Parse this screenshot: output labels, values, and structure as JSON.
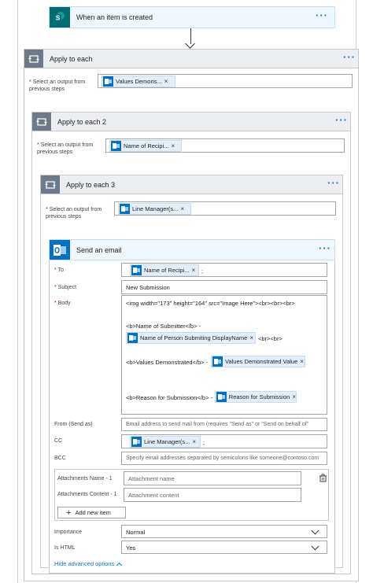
{
  "trigger": {
    "title": "When an item is created"
  },
  "loop1": {
    "title": "Apply to each",
    "label": "Select an output from previous steps",
    "token": "Values Demons..."
  },
  "loop2": {
    "title": "Apply to each 2",
    "label": "Select an output from previous steps",
    "token": "Name of Recipi..."
  },
  "loop3": {
    "title": "Apply to each 3",
    "label": "Select an output from previous steps",
    "token": "Line Manager(s..."
  },
  "email": {
    "title": "Send an email",
    "to_label": "To",
    "to_token": "Name of Recipi...",
    "to_suffix": ";",
    "subject_label": "Subject",
    "subject_value": "New Submission",
    "body_label": "Body",
    "body_line1": "<img width=\"173\" height=\"164\" src=\"Image Here\"><br><br><br>",
    "body_line2": "<b>Name of Submitter</b> -",
    "body_token1": "Name of Person Submiting DisplayName",
    "body_after1": "<br><br>",
    "body_line3": "<b>Values Demonstrated</b> -",
    "body_token2": "Values Demonstrated Value",
    "body_line4": "<b>Reason for Submission</b> -",
    "body_token3": "Reason for Submission",
    "from_label": "From (Send as)",
    "from_placeholder": "Email address to send mail from (requires \"Send as\" or \"Send on behalf of\"",
    "cc_label": "CC",
    "cc_token": "Line Manager(s...",
    "cc_suffix": ";",
    "bcc_label": "BCC",
    "bcc_placeholder": "Specify email addresses separated by semicolons like someone@contoso.com",
    "att_name_label": "Attachments Name - 1",
    "att_name_placeholder": "Attachment name",
    "att_content_label": "Attachments Content - 1",
    "att_content_placeholder": "Attachment content",
    "add_item": "Add new item",
    "importance_label": "Importance",
    "importance_value": "Normal",
    "ishtml_label": "Is HTML",
    "ishtml_value": "Yes",
    "advanced": "Hide advanced options"
  },
  "colors": {
    "sharepoint": "#036c70",
    "loop": "#6e7a8a",
    "outlook": "#0072c6",
    "accent": "#0078d4"
  }
}
